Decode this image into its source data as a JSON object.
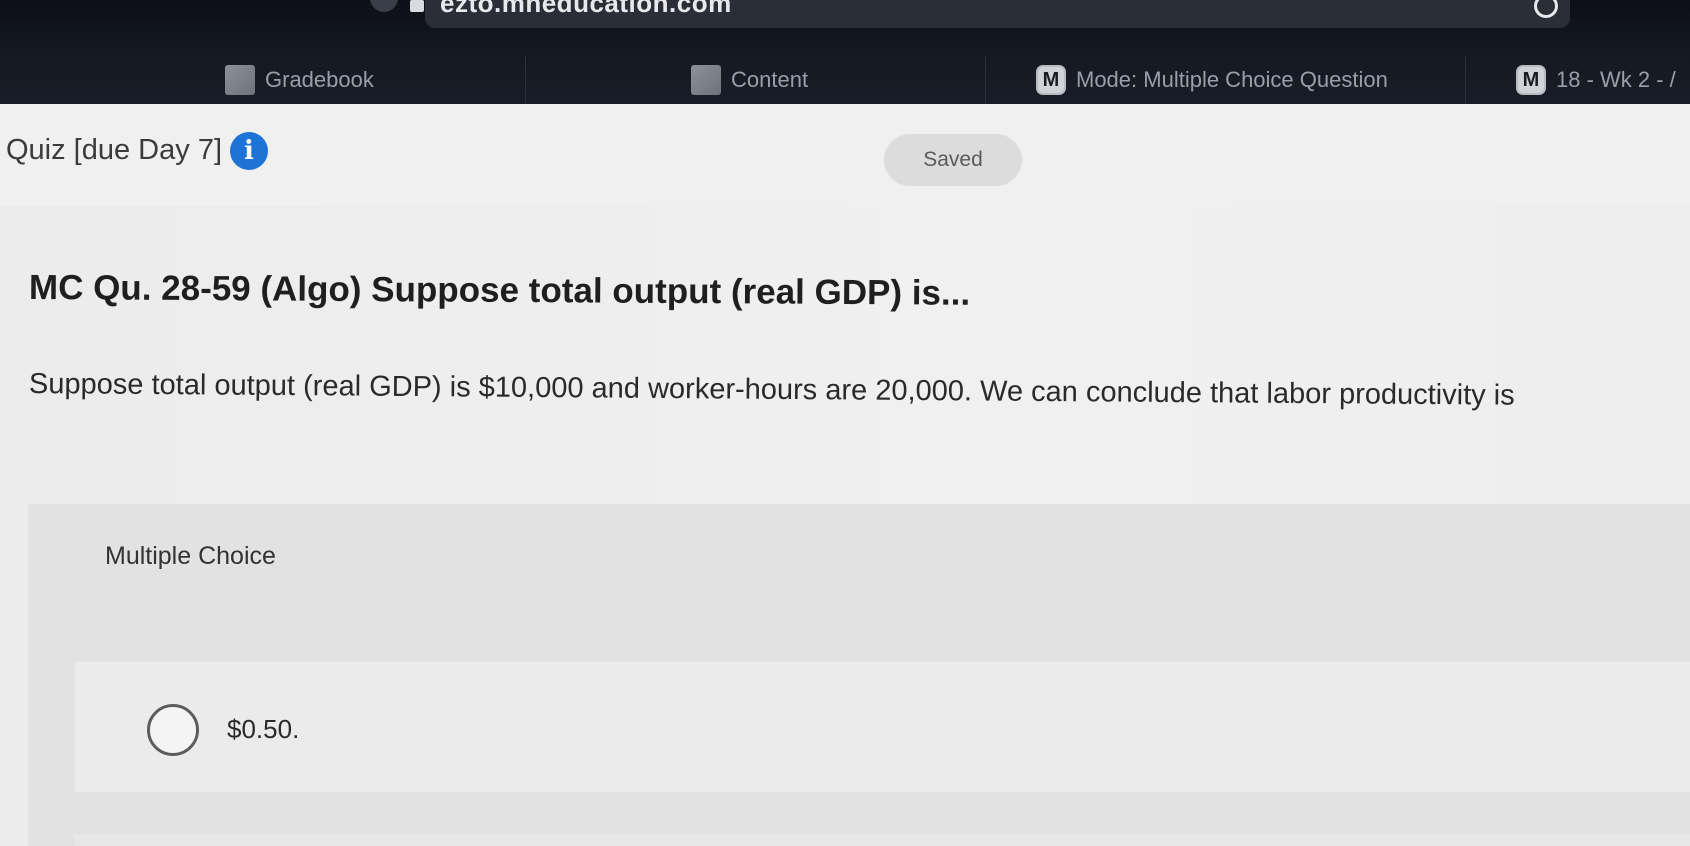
{
  "browser": {
    "url": "ezto.mheducation.com"
  },
  "bookmarks": [
    {
      "label": "Gradebook",
      "icon": "edit-square-icon"
    },
    {
      "label": "Content",
      "icon": "edit-square-icon"
    },
    {
      "label": "Mode: Multiple Choice Question",
      "icon": "m-logo-icon",
      "badge": "M"
    },
    {
      "label": "18 - Wk 2 - /",
      "icon": "m-logo-icon",
      "badge": "M"
    }
  ],
  "quiz": {
    "title": "Quiz [due Day 7]",
    "info_icon": "i",
    "status": "Saved"
  },
  "question": {
    "title": "MC Qu. 28-59 (Algo) Suppose total output (real GDP) is...",
    "text": "Suppose total output (real GDP) is $10,000 and worker-hours are 20,000. We can conclude that labor productivity is"
  },
  "answers": {
    "section_label": "Multiple Choice",
    "options": [
      {
        "label": "$0.50.",
        "selected": false
      }
    ]
  }
}
